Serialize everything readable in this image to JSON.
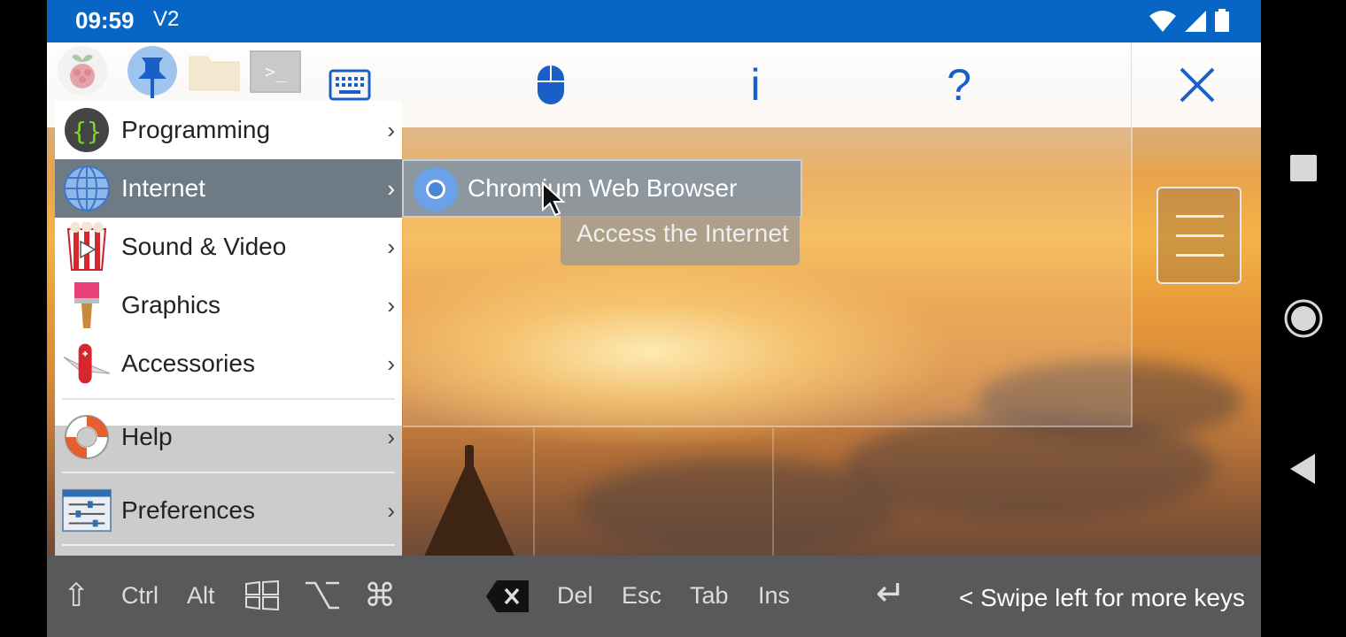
{
  "status_bar": {
    "time": "09:59",
    "extra": "V2",
    "icons": [
      "wifi-icon",
      "cellular-signal-icon",
      "battery-icon"
    ]
  },
  "toolbar": {
    "buttons": [
      {
        "name": "raspberry-pi-menu-icon"
      },
      {
        "name": "pin-icon"
      },
      {
        "name": "file-manager-icon"
      },
      {
        "name": "terminal-icon",
        "label": ">_"
      },
      {
        "name": "keyboard-icon"
      },
      {
        "name": "mouse-icon"
      },
      {
        "name": "info-icon",
        "label": "i"
      },
      {
        "name": "help-icon",
        "label": "?"
      },
      {
        "name": "close-icon",
        "label": "×"
      }
    ]
  },
  "menu": {
    "items": [
      {
        "label": "Programming",
        "icon": "programming-icon"
      },
      {
        "label": "Internet",
        "icon": "globe-icon"
      },
      {
        "label": "Sound & Video",
        "icon": "sound-video-icon"
      },
      {
        "label": "Graphics",
        "icon": "paintbrush-icon"
      },
      {
        "label": "Accessories",
        "icon": "swiss-knife-icon"
      },
      {
        "label": "Help",
        "icon": "lifebuoy-icon"
      },
      {
        "label": "Preferences",
        "icon": "preferences-icon"
      }
    ],
    "arrow": "›"
  },
  "submenu": {
    "item": "Chromium Web Browser",
    "tooltip": "Access the Internet"
  },
  "keys": {
    "shift": "⇧",
    "ctrl": "Ctrl",
    "alt": "Alt",
    "cmd": "⌘",
    "del": "Del",
    "esc": "Esc",
    "tab": "Tab",
    "ins": "Ins",
    "enter": "↵",
    "hint": "< Swipe left for more keys"
  },
  "colors": {
    "status_bar": "#0765c6",
    "toolbar_icon": "#1a5fc8",
    "menu_active": "#6e7b85",
    "keys_bar": "#57595b"
  }
}
